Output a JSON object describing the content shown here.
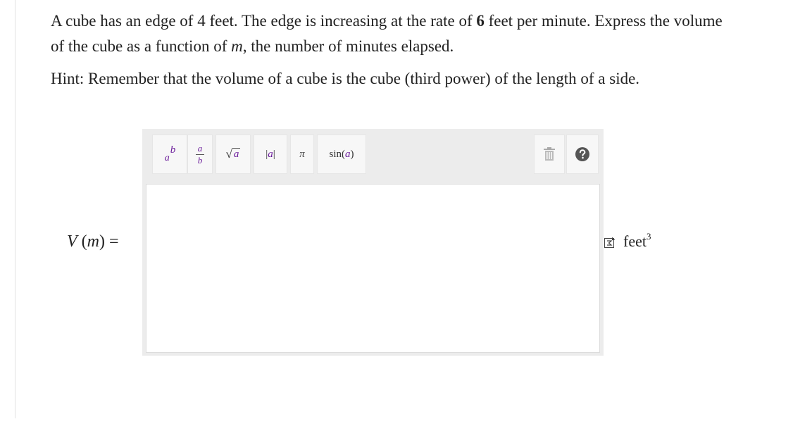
{
  "problem": {
    "line1_part1": "A cube has an edge of 4 feet. The edge is increasing at the rate of ",
    "line1_bold_number": "6",
    "line1_part2": " feet per minute. Express the volume",
    "line2_part1": "of the cube as a function of ",
    "variable": "m",
    "line2_part2": ", the number of minutes elapsed.",
    "hint": "Hint: Remember that the volume of a cube is the cube (third power) of the length of a side."
  },
  "answer": {
    "lhs_func": "V",
    "lhs_open": " (",
    "lhs_var": "m",
    "lhs_close": ") =",
    "input_value": ""
  },
  "toolbar": {
    "power_base": "a",
    "power_exp": "b",
    "fraction_num": "a",
    "fraction_den": "b",
    "sqrt_symbol": "√",
    "sqrt_arg": "a",
    "abs_label": "|a|",
    "abs_arg": "a",
    "pi_label": "π",
    "sin_func": "sin",
    "sin_open": " (",
    "sin_arg": "a",
    "sin_close": ")",
    "icons": [
      "trash-icon",
      "help-icon"
    ]
  },
  "units": {
    "text": "feet",
    "exponent": "3",
    "icon": "sigma-units-icon"
  },
  "colors": {
    "editor_bg": "#ececec",
    "button_bg": "#f7f7f7",
    "variable_purple": "#6a1b9a",
    "help_icon": "#555555"
  }
}
